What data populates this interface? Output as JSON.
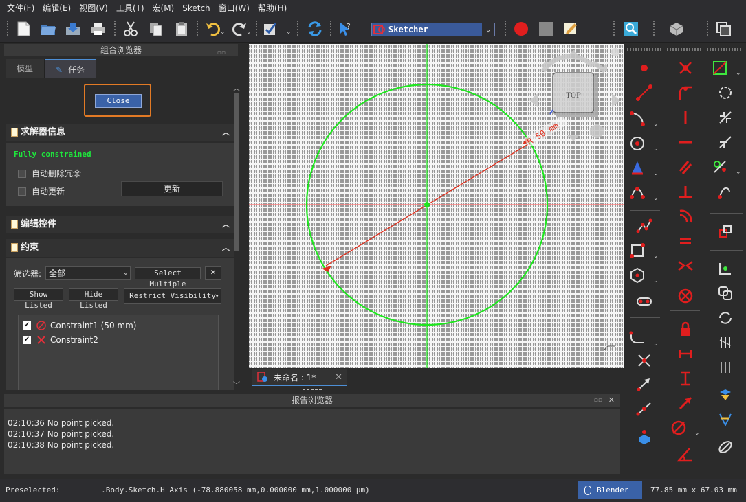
{
  "menu": [
    "文件(F)",
    "编辑(E)",
    "视图(V)",
    "工具(T)",
    "宏(M)",
    "Sketch",
    "窗口(W)",
    "帮助(H)"
  ],
  "toolbar": {
    "workbench": "Sketcher"
  },
  "combo": {
    "title": "组合浏览器",
    "tabs": [
      "模型",
      "任务"
    ],
    "close_label": "Close",
    "solver": {
      "header": "求解器信息",
      "status": "Fully constrained",
      "auto_remove_redundants": "自动删除冗余",
      "auto_update": "自动更新",
      "update_button": "更新"
    },
    "edit_controls": {
      "header": "编辑控件"
    },
    "constraints": {
      "header": "约束",
      "filter_label": "筛选器:",
      "filter_value": "全部",
      "select_multiple": "Select Multiple",
      "show_listed": "Show Listed",
      "hide_listed": "Hide Listed",
      "restrict_visibility": "Restrict Visibility",
      "items": [
        {
          "label": "Constraint1 (50 mm)",
          "checked": true,
          "icon": "radius-constraint-icon"
        },
        {
          "label": "Constraint2",
          "checked": true,
          "icon": "coincident-constraint-icon"
        }
      ]
    }
  },
  "view3d": {
    "navcube_face": "TOP",
    "dimension_label": "R 50 mm",
    "colors": {
      "circle": "#1ee61e",
      "dimension": "#e0301e",
      "axis_v": "#3ee63e",
      "axis_h": "#ff8080"
    }
  },
  "doc_tab": {
    "label": "未命名 : 1*"
  },
  "report": {
    "title": "报告浏览器",
    "lines": [
      "02:10:36  No point picked.",
      "02:10:37  No point picked.",
      "02:10:38  No point picked."
    ]
  },
  "status": {
    "preselected": "Preselected: ________.Body.Sketch.H_Axis (-78.880058 mm,0.000000 mm,1.000000 μm)",
    "nav_style": "Blender",
    "dimensions": "77.85 mm x 67.03 mm"
  }
}
